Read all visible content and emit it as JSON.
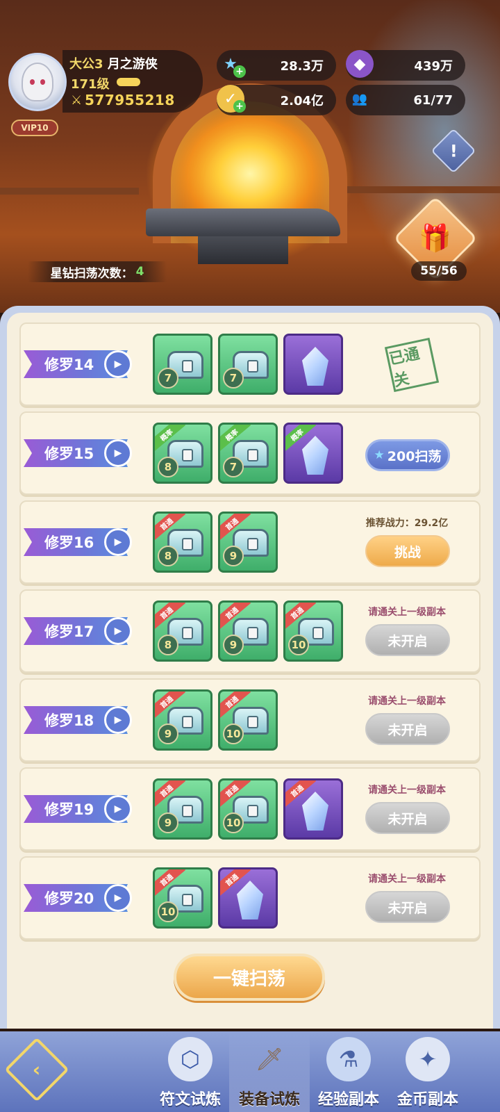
{
  "player": {
    "name_tag": "大公3",
    "name": "月之游侠",
    "level": "171级",
    "power": "577955218",
    "vip": "VIP10"
  },
  "resources": {
    "star_diamond": "28.3万",
    "gold": "2.04亿",
    "purple_currency": "439万",
    "members": "61/77"
  },
  "header": {
    "sweep_count_label": "星钻扫荡次数：",
    "sweep_count_value": "4",
    "gift_progress": "55/56"
  },
  "corner_labels": {
    "first_clear": "首通",
    "probability": "概率"
  },
  "stages": [
    {
      "name": "修罗14",
      "items": [
        {
          "type": "chest",
          "qty": "7"
        },
        {
          "type": "chest",
          "qty": "7"
        },
        {
          "type": "crystal"
        }
      ],
      "status": "已通关"
    },
    {
      "name": "修罗15",
      "items": [
        {
          "type": "chest",
          "qty": "8",
          "corner": "概率"
        },
        {
          "type": "chest",
          "qty": "7",
          "corner": "概率"
        },
        {
          "type": "crystal",
          "corner": "概率"
        }
      ],
      "button": "200扫荡"
    },
    {
      "name": "修罗16",
      "items": [
        {
          "type": "chest",
          "qty": "8",
          "corner": "首通"
        },
        {
          "type": "chest",
          "qty": "9",
          "corner": "首通"
        }
      ],
      "note": "推荐战力：29.2亿",
      "button": "挑战"
    },
    {
      "name": "修罗17",
      "items": [
        {
          "type": "chest",
          "qty": "8",
          "corner": "首通"
        },
        {
          "type": "chest",
          "qty": "9",
          "corner": "首通"
        },
        {
          "type": "chest",
          "qty": "10",
          "corner": "首通"
        }
      ],
      "note": "请通关上一级副本",
      "button": "未开启"
    },
    {
      "name": "修罗18",
      "items": [
        {
          "type": "chest",
          "qty": "9",
          "corner": "首通"
        },
        {
          "type": "chest",
          "qty": "10",
          "corner": "首通"
        }
      ],
      "note": "请通关上一级副本",
      "button": "未开启"
    },
    {
      "name": "修罗19",
      "items": [
        {
          "type": "chest",
          "qty": "9",
          "corner": "首通"
        },
        {
          "type": "chest",
          "qty": "10",
          "corner": "首通"
        },
        {
          "type": "crystal",
          "corner": "首通"
        }
      ],
      "note": "请通关上一级副本",
      "button": "未开启"
    },
    {
      "name": "修罗20",
      "items": [
        {
          "type": "chest",
          "qty": "10",
          "corner": "首通"
        },
        {
          "type": "crystal",
          "corner": "首通"
        }
      ],
      "note": "请通关上一级副本",
      "button": "未开启"
    }
  ],
  "sweep_all_button": "一键扫荡",
  "bottom_nav": [
    {
      "label": "符文试炼",
      "icon": "rune-icon",
      "active": false
    },
    {
      "label": "装备试炼",
      "icon": "sword-icon",
      "active": true
    },
    {
      "label": "经验副本",
      "icon": "potion-icon",
      "active": false
    },
    {
      "label": "金币副本",
      "icon": "coin-icon",
      "active": false
    }
  ],
  "colors": {
    "panel_bg": "#f6efde",
    "stage_tab": "#6d77d8",
    "challenge_btn": "#eeaa4a",
    "locked_btn": "#b0b0b0",
    "sweep_btn": "#5a72c8"
  }
}
